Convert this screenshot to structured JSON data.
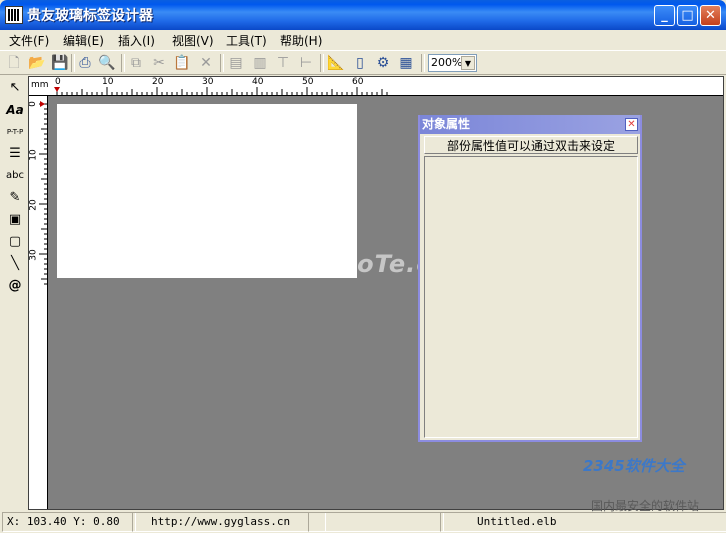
{
  "window": {
    "title": "贵友玻璃标签设计器",
    "minimize_glyph": "_",
    "maximize_glyph": "□",
    "close_glyph": "✕"
  },
  "menu": [
    {
      "label": "文件(F)"
    },
    {
      "label": "编辑(E)"
    },
    {
      "label": "插入(I)"
    },
    {
      "label": "视图(V)"
    },
    {
      "label": "工具(T)"
    },
    {
      "label": "帮助(H)"
    }
  ],
  "toolbar": {
    "icons": [
      "new-icon",
      "open-icon",
      "save-icon",
      "print-icon",
      "print-preview-icon",
      "copy-icon",
      "cut-icon",
      "paste-icon",
      "delete-icon",
      "bring-front-icon",
      "send-back-icon",
      "align-top-icon",
      "align-left-icon",
      "properties-icon",
      "page-icon",
      "settings-icon",
      "table-icon"
    ],
    "zoom_value": "200%"
  },
  "palette": {
    "items": [
      {
        "name": "pointer-tool-icon",
        "glyph": "↖"
      },
      {
        "name": "text-tool-icon",
        "glyph": "Aa"
      },
      {
        "name": "ptp-tool-icon",
        "glyph": "P-T-P"
      },
      {
        "name": "paragraph-tool-icon",
        "glyph": "☰"
      },
      {
        "name": "abc-tool-icon",
        "glyph": "abc"
      },
      {
        "name": "pen-tool-icon",
        "glyph": "✎"
      },
      {
        "name": "image-tool-icon",
        "glyph": "▣"
      },
      {
        "name": "rectangle-tool-icon",
        "glyph": "▢"
      },
      {
        "name": "line-tool-icon",
        "glyph": "╲"
      },
      {
        "name": "at-tool-icon",
        "glyph": "@"
      }
    ]
  },
  "ruler": {
    "unit": "mm",
    "h_labels": [
      "0",
      "10",
      "20",
      "30",
      "40",
      "50",
      "60"
    ],
    "v_labels": [
      "0",
      "10",
      "20",
      "30"
    ]
  },
  "watermark": "www.DuoTe.com",
  "properties": {
    "title": "对象属性",
    "close_glyph": "✕",
    "hint": "部份属性值可以通过双击来设定"
  },
  "status": {
    "coords": "X: 103.40  Y: 0.80",
    "url": "http://www.gyglass.cn",
    "empty": "",
    "filename": "Untitled.elb"
  },
  "corner_logo": {
    "brand": "2345软件大全",
    "sub": "国内最安全的软件站"
  }
}
